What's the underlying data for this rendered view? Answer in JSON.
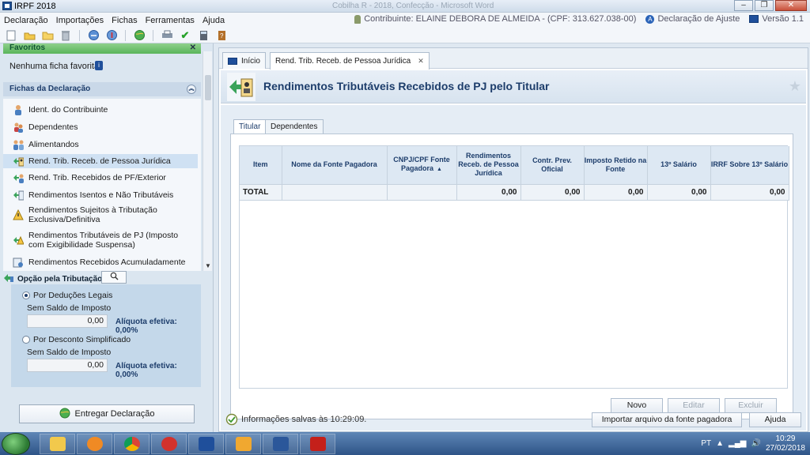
{
  "window": {
    "title": "IRPF 2018",
    "faded_title": "Cobilha R - 2018, Confecção - Microsoft Word"
  },
  "menu": {
    "items": [
      "Declaração",
      "Importações",
      "Fichas",
      "Ferramentas",
      "Ajuda"
    ],
    "contribuinte": "Contribuinte: ELAINE DEBORA DE ALMEIDA - (CPF: 313.627.038-00)",
    "declaracao_tipo": "Declaração de Ajuste",
    "versao": "Versão 1.1"
  },
  "left": {
    "favoritos_header": "Favoritos",
    "nenhuma_favorita": "Nenhuma ficha favorita",
    "fichas_header": "Fichas da Declaração",
    "fichas": [
      "Ident. do Contribuinte",
      "Dependentes",
      "Alimentandos",
      "Rend. Trib. Receb. de Pessoa Jurídica",
      "Rend. Trib. Recebidos de PF/Exterior",
      "Rendimentos Isentos e Não Tributáveis",
      "Rendimentos Sujeitos à Tributação Exclusiva/Definitiva",
      "Rendimentos Tributáveis de PJ (Imposto com Exigibilidade Suspensa)",
      "Rendimentos Recebidos Acumuladamente"
    ],
    "opcao_label": "Opção pela Tributação:",
    "opcao_deducoes": "Por Deduções Legais",
    "sem_saldo_1": "Sem Saldo de Imposto",
    "valor_1": "0,00",
    "aliquota_1": "Alíquota efetiva: 0,00%",
    "opcao_simplificado": "Por Desconto Simplificado",
    "sem_saldo_2": "Sem Saldo de Imposto",
    "valor_2": "0,00",
    "aliquota_2": "Alíquota efetiva: 0,00%",
    "entregar": "Entregar Declaração"
  },
  "main": {
    "tabs": [
      "Início",
      "Rend. Trib. Receb. de Pessoa Jurídica"
    ],
    "page_title": "Rendimentos Tributáveis Recebidos de PJ pelo Titular",
    "subtabs": [
      "Titular",
      "Dependentes"
    ],
    "table": {
      "headers": [
        "Item",
        "Nome da Fonte Pagadora",
        "CNPJ/CPF Fonte Pagadora",
        "Rendimentos Receb. de Pessoa Jurídica",
        "Contr. Prev. Oficial",
        "Imposto Retido na Fonte",
        "13º Salário",
        "IRRF Sobre 13º Salário"
      ],
      "total_label": "TOTAL",
      "totals": [
        "0,00",
        "0,00",
        "0,00",
        "0,00",
        "0,00"
      ]
    },
    "buttons": {
      "novo": "Novo",
      "editar": "Editar",
      "excluir": "Excluir",
      "importar": "Importar arquivo da fonte pagadora",
      "ajuda": "Ajuda"
    },
    "status": "Informações salvas às 10:29:09."
  },
  "taskbar": {
    "lang": "PT",
    "time": "10:29",
    "date": "27/02/2018"
  },
  "colors": {
    "accent": "#1d3d6b",
    "favoritos_green": "#5ab55a",
    "taskbar": "#2e5487"
  }
}
